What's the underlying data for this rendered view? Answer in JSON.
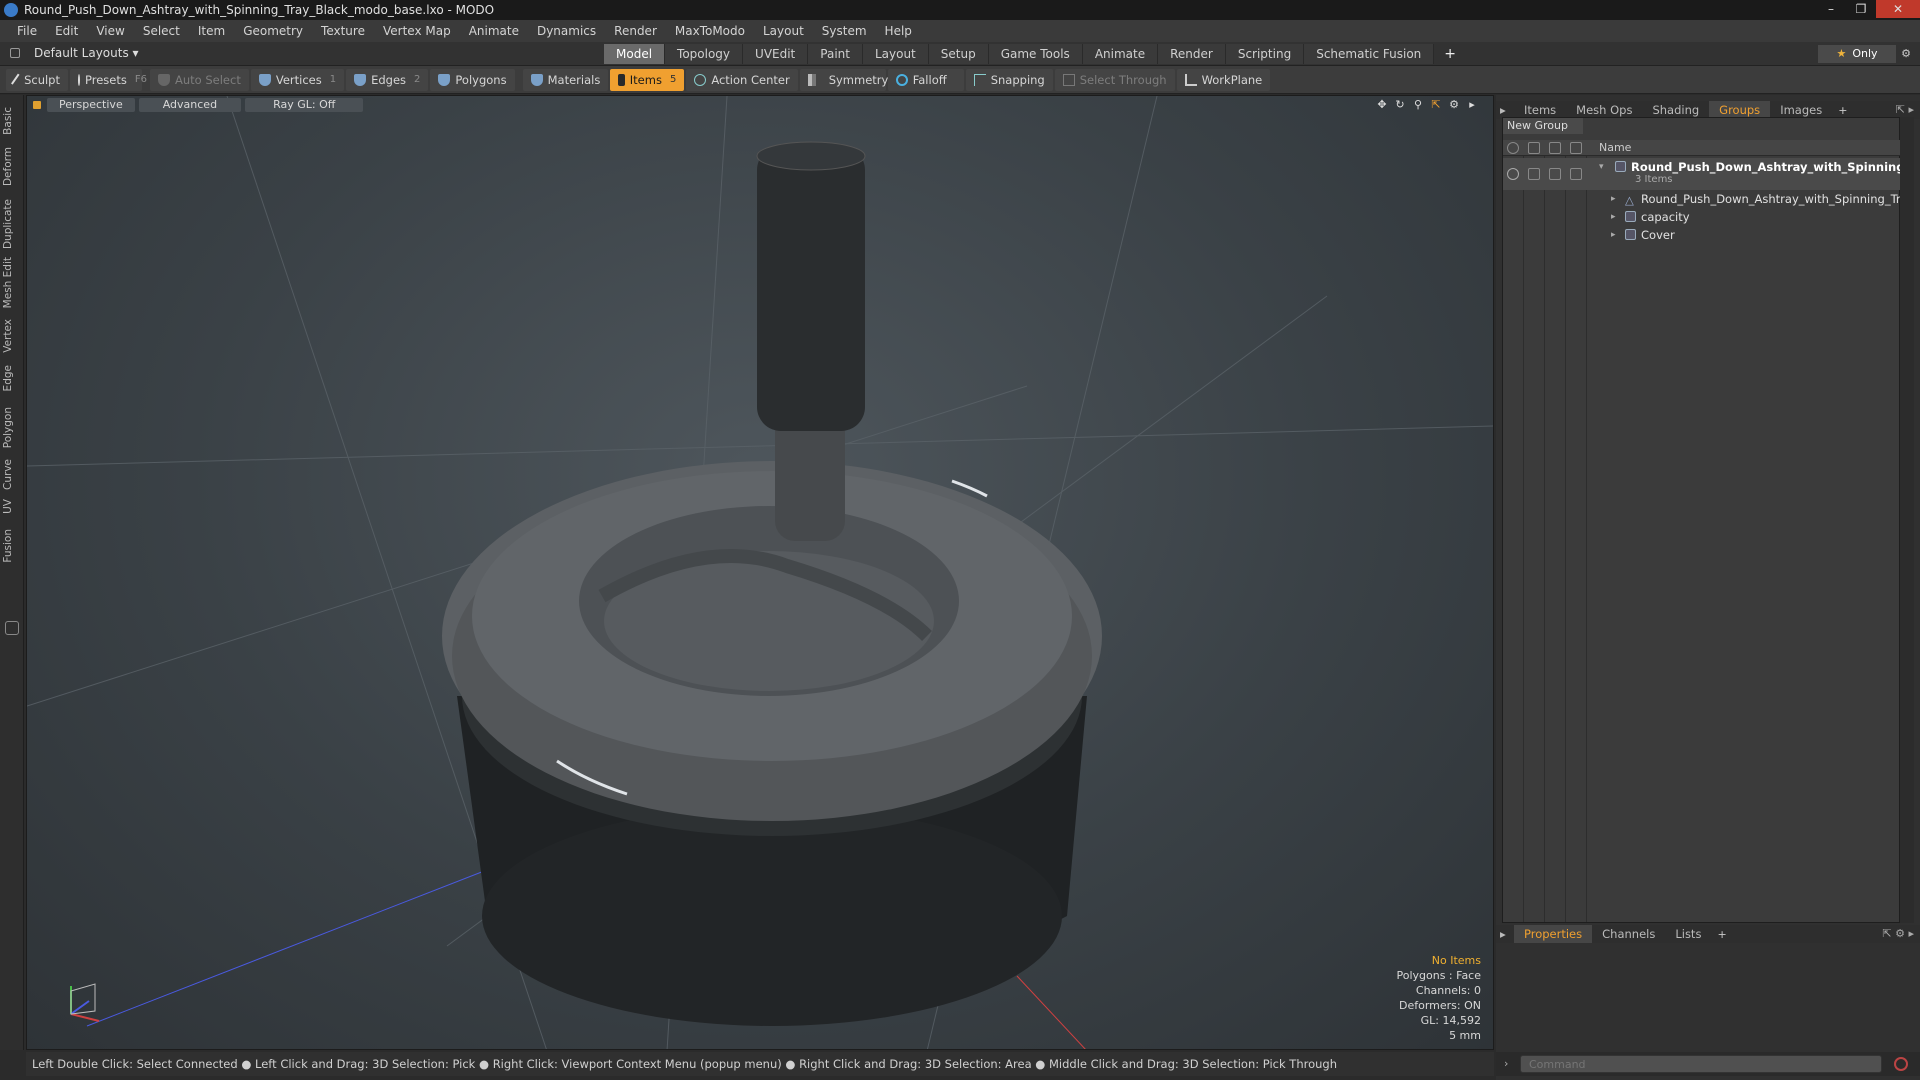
{
  "window": {
    "title": "Round_Push_Down_Ashtray_with_Spinning_Tray_Black_modo_base.lxo - MODO"
  },
  "menu": [
    "File",
    "Edit",
    "View",
    "Select",
    "Item",
    "Geometry",
    "Texture",
    "Vertex Map",
    "Animate",
    "Dynamics",
    "Render",
    "MaxToModo",
    "Layout",
    "System",
    "Help"
  ],
  "layout": {
    "dropdown": "Default Layouts ▾",
    "tabs": [
      "Model",
      "Topology",
      "UVEdit",
      "Paint",
      "Layout",
      "Setup",
      "Game Tools",
      "Animate",
      "Render",
      "Scripting",
      "Schematic Fusion"
    ],
    "active_tab": "Model",
    "only_label": "Only"
  },
  "toolbar": {
    "sculpt": "Sculpt",
    "presets": "Presets",
    "presets_key": "F6",
    "auto_select": "Auto Select",
    "vertices": "Vertices",
    "vertices_key": "1",
    "edges": "Edges",
    "edges_key": "2",
    "polygons": "Polygons",
    "materials": "Materials",
    "items": "Items",
    "items_key": "5",
    "action_center": "Action Center",
    "symmetry": "Symmetry",
    "falloff": "Falloff",
    "snapping": "Snapping",
    "select_through": "Select Through",
    "workplane": "WorkPlane"
  },
  "left_tabs": [
    "Basic",
    "Deform",
    "Duplicate",
    "Mesh Edit",
    "Vertex",
    "Edge",
    "Polygon",
    "Curve",
    "UV",
    "Fusion"
  ],
  "viewport": {
    "view": "Perspective",
    "shading": "Advanced",
    "raygl": "Ray GL: Off",
    "info": {
      "selection": "No Items",
      "polygons": "Polygons : Face",
      "channels": "Channels: 0",
      "deformers": "Deformers: ON",
      "gl": "GL: 14,592",
      "scale": "5 mm"
    }
  },
  "status": "Left Double Click: Select Connected ● Left Click and Drag: 3D Selection: Pick ● Right Click: Viewport Context Menu (popup menu) ● Right Click and Drag: 3D Selection: Area ● Middle Click and Drag: 3D Selection: Pick Through",
  "panel": {
    "tabs": [
      "Items",
      "Mesh Ops",
      "Shading",
      "Groups",
      "Images"
    ],
    "active_tab": "Groups",
    "new_group": "New Group",
    "name_header": "Name",
    "group_name": "Round_Push_Down_Ashtray_with_Spinning_T...",
    "group_count": "3 Items",
    "children": [
      "Round_Push_Down_Ashtray_with_Spinning_Tray_B...",
      "capacity",
      "Cover"
    ]
  },
  "props": {
    "tabs": [
      "Properties",
      "Channels",
      "Lists"
    ],
    "active_tab": "Properties"
  },
  "command": {
    "placeholder": "Command"
  },
  "colors": {
    "accent": "#f0a030",
    "viewport_bg": "#3a4146"
  }
}
